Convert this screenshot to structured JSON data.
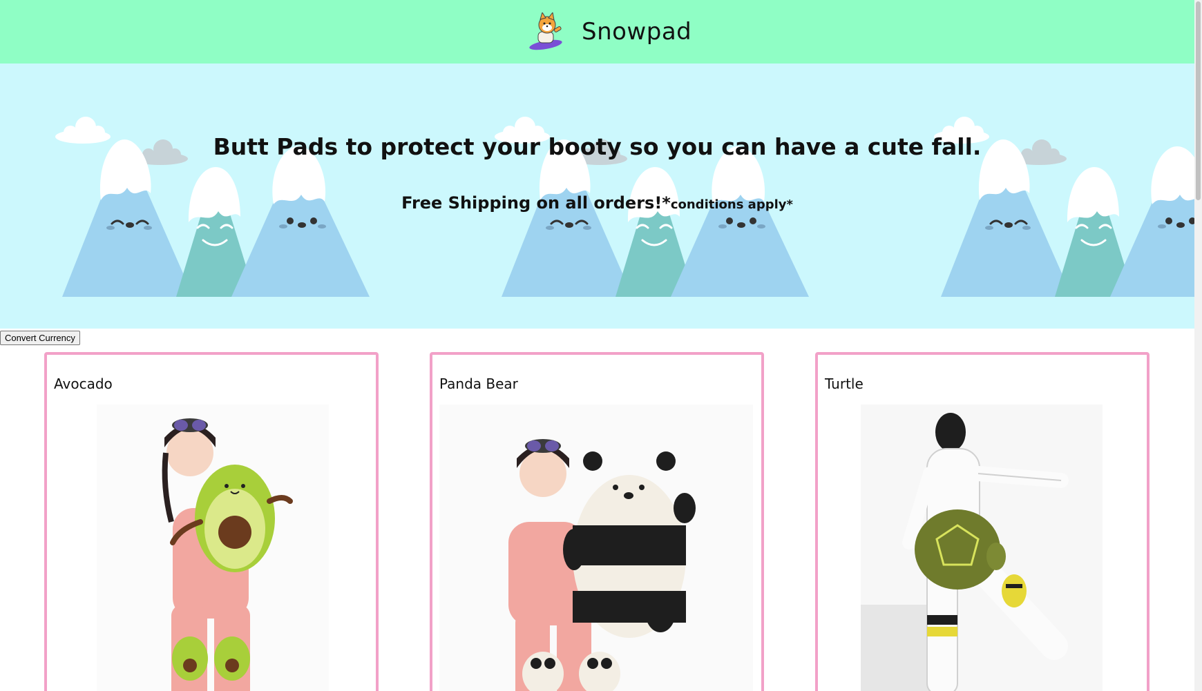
{
  "header": {
    "brand_name": "Snowpad",
    "logo_icon": "shiba-snowboard-logo-icon"
  },
  "hero": {
    "headline": "Butt Pads to protect your booty so you can have a cute fall.",
    "shipping": "Free Shipping on all orders!*",
    "conditions": "conditions apply*"
  },
  "controls": {
    "convert_currency_label": "Convert Currency"
  },
  "products": [
    {
      "name": "Avocado"
    },
    {
      "name": "Panda Bear"
    },
    {
      "name": "Turtle"
    }
  ],
  "colors": {
    "header_bg": "#8ffec5",
    "hero_bg": "#ccf8fd",
    "card_border": "#f2a1c8",
    "mountain_blue": "#9ed3f0",
    "mountain_teal": "#7cc9c6"
  }
}
